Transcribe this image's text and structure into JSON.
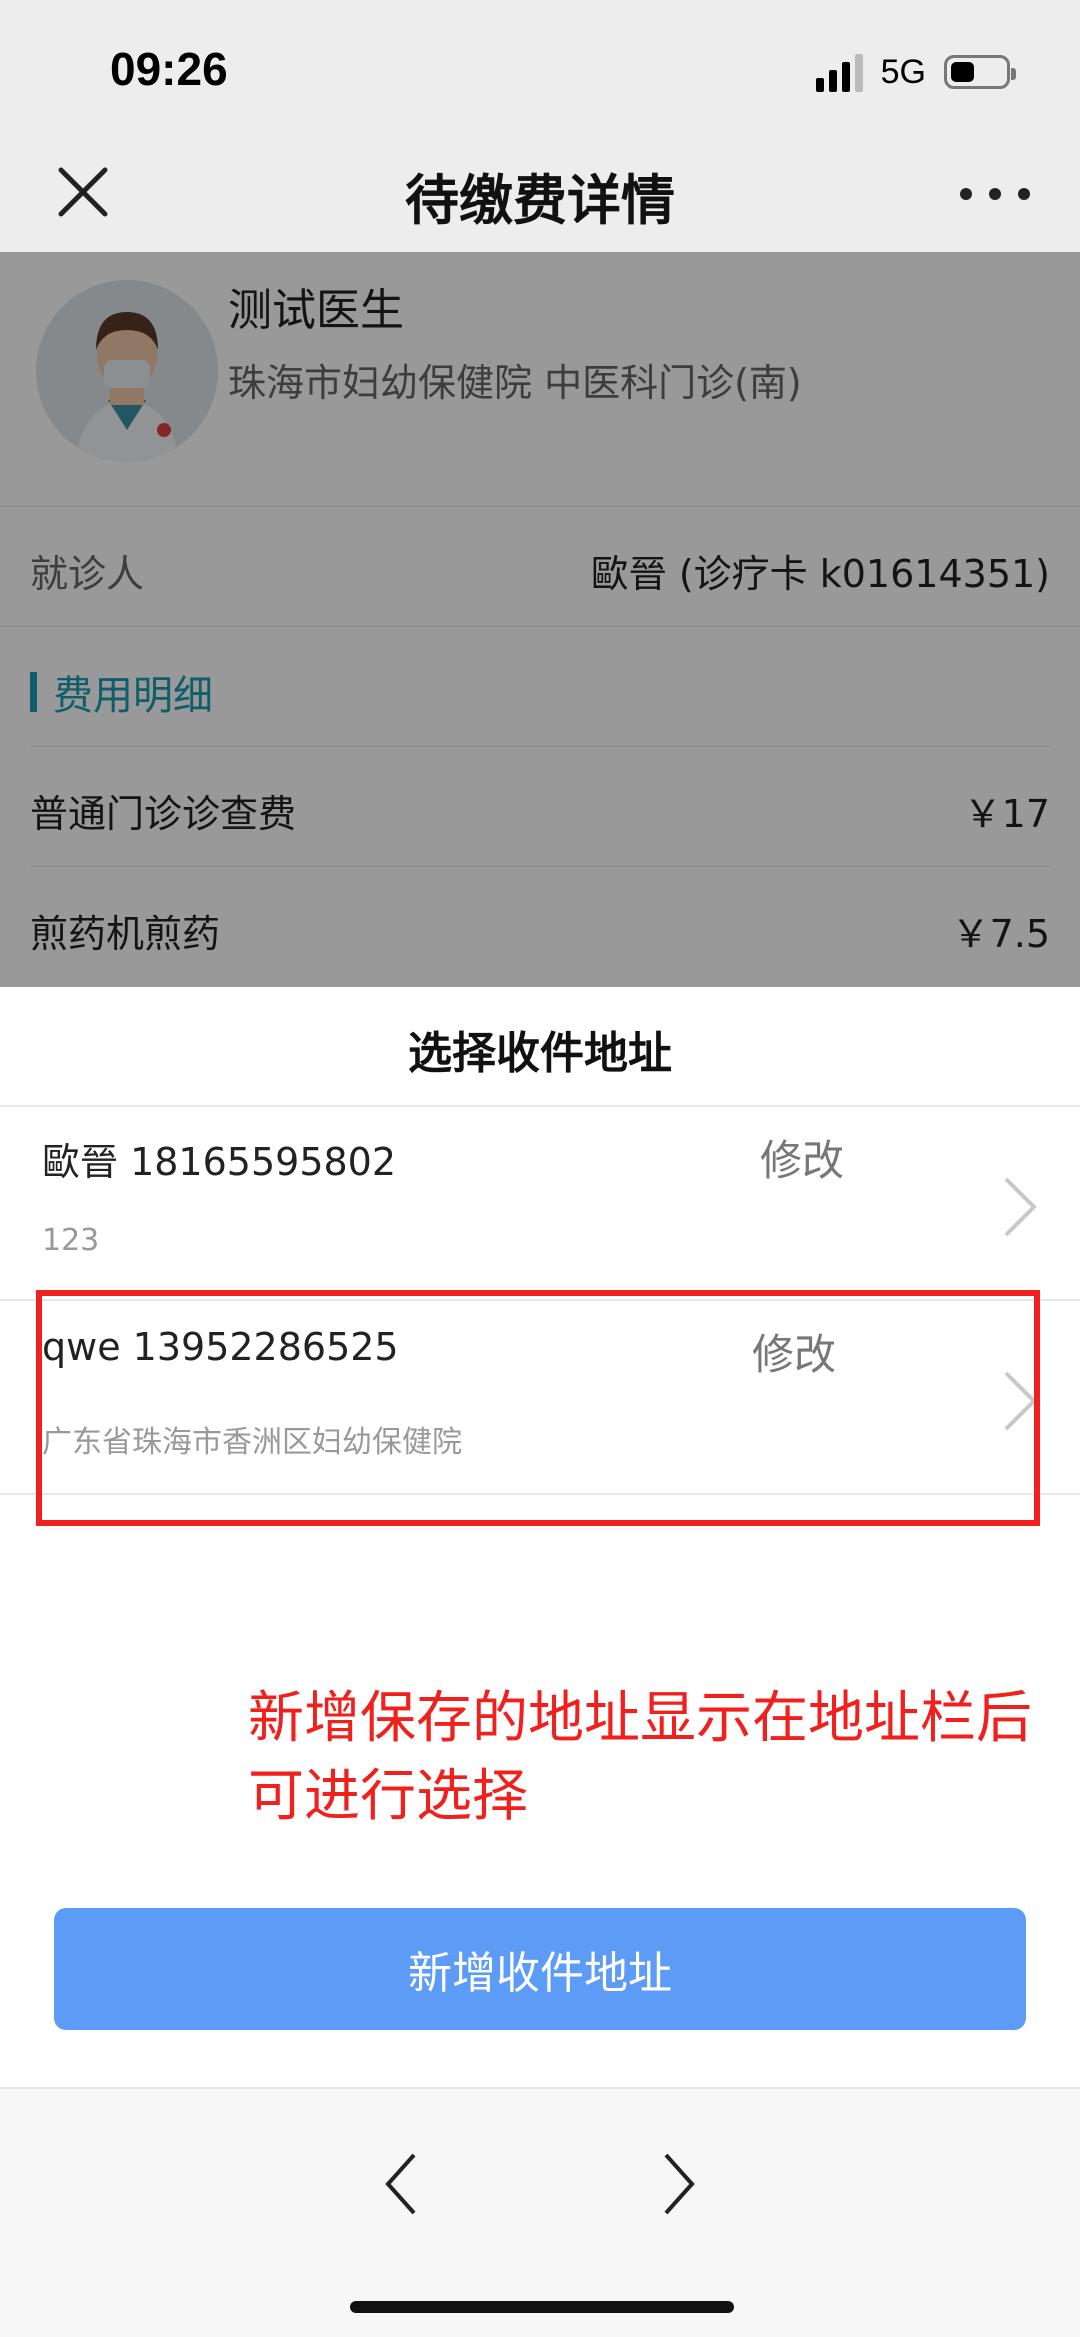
{
  "status_bar": {
    "time": "09:26",
    "network": "5G",
    "battery_level": 0.45
  },
  "nav": {
    "title": "待缴费详情",
    "close_icon": "close-icon",
    "more_icon": "more-icon"
  },
  "doctor": {
    "name": "测试医生",
    "hospital_dept": "珠海市妇幼保健院 中医科门诊(南)"
  },
  "patient_row": {
    "label": "就诊人",
    "value": "歐晉 (诊疗卡 k01614351)"
  },
  "fee_section": {
    "title": "费用明细",
    "items": [
      {
        "name": "普通门诊诊查费",
        "amount": "￥17"
      },
      {
        "name": "煎药机煎药",
        "amount": "￥7.5"
      }
    ]
  },
  "sheet": {
    "title": "选择收件地址",
    "addresses": [
      {
        "name_phone": "歐晉 18165595802",
        "edit_label": "修改",
        "detail": "123"
      },
      {
        "name_phone": "qwe 13952286525",
        "edit_label": "修改",
        "detail": "广东省珠海市香洲区妇幼保健院"
      }
    ],
    "annotation": "新增保存的地址显示在地址栏后可进行选择",
    "add_button": "新增收件地址",
    "annotation_color": "#f0201d",
    "button_color": "#5c9cf7"
  },
  "toolbar": {
    "back_icon": "chevron-left-icon",
    "forward_icon": "chevron-right-icon"
  }
}
